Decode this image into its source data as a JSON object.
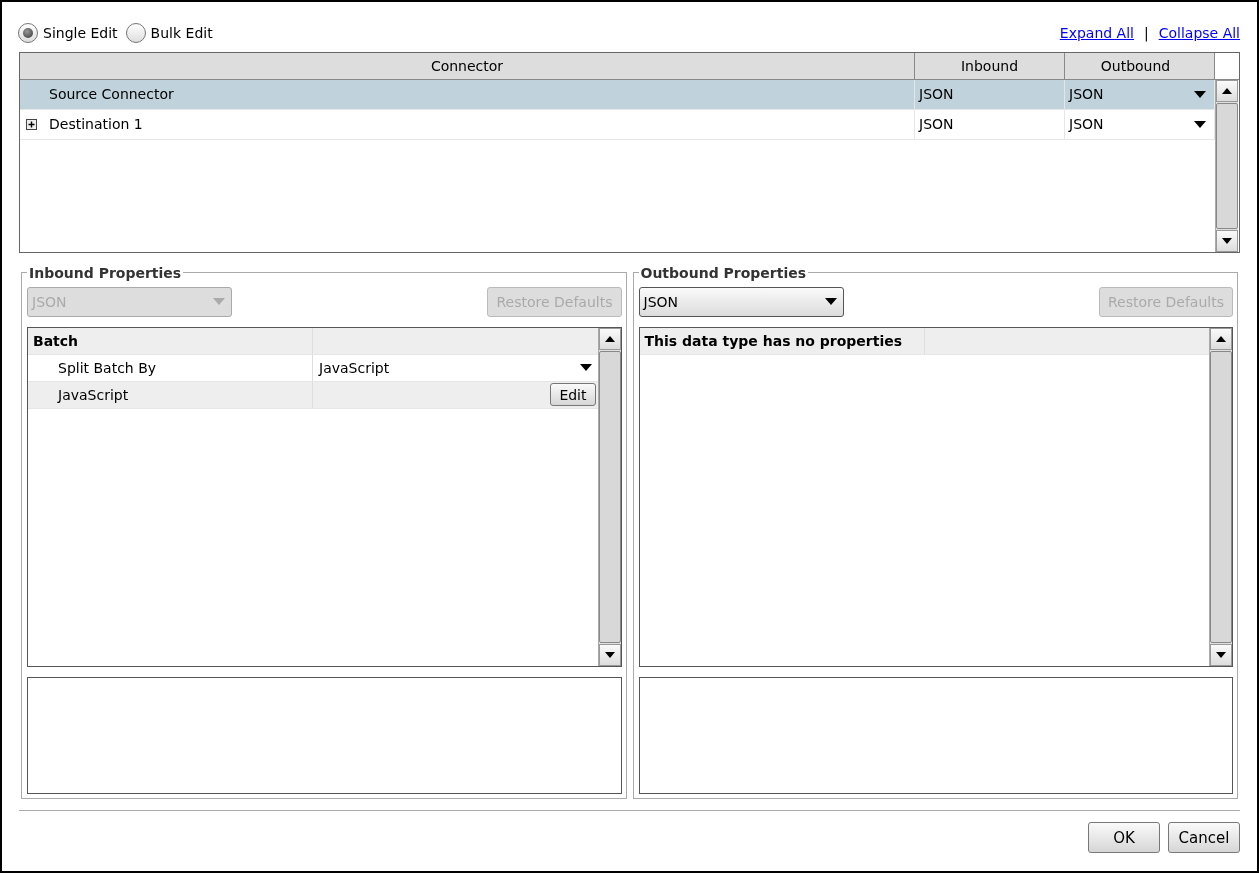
{
  "mode_options": [
    {
      "label": "Single Edit",
      "selected": true
    },
    {
      "label": "Bulk Edit",
      "selected": false
    }
  ],
  "links": {
    "expand": "Expand All",
    "separator": "|",
    "collapse": "Collapse All"
  },
  "connector_table": {
    "columns": [
      "Connector",
      "Inbound",
      "Outbound"
    ],
    "rows": [
      {
        "name": "Source Connector",
        "inbound": "JSON",
        "outbound": "JSON",
        "selected": true,
        "expandable": false
      },
      {
        "name": "Destination 1",
        "inbound": "JSON",
        "outbound": "JSON",
        "selected": false,
        "expandable": true
      }
    ]
  },
  "panels": [
    {
      "title": "Inbound Properties",
      "data_type": "JSON",
      "disabled": true,
      "restore_button": {
        "label": "Restore Defaults",
        "disabled": true
      },
      "properties": [
        {
          "kind": "group",
          "label": "Batch"
        },
        {
          "kind": "dropdown",
          "label": "Split Batch By",
          "value": "JavaScript"
        },
        {
          "kind": "button",
          "label": "JavaScript",
          "button": "Edit"
        }
      ]
    },
    {
      "title": "Outbound Properties",
      "data_type": "JSON",
      "disabled": false,
      "restore_button": {
        "label": "Restore Defaults",
        "disabled": true
      },
      "properties": [
        {
          "kind": "group",
          "label": "This data type has no properties"
        }
      ]
    }
  ],
  "buttons": [
    "OK",
    "Cancel"
  ]
}
